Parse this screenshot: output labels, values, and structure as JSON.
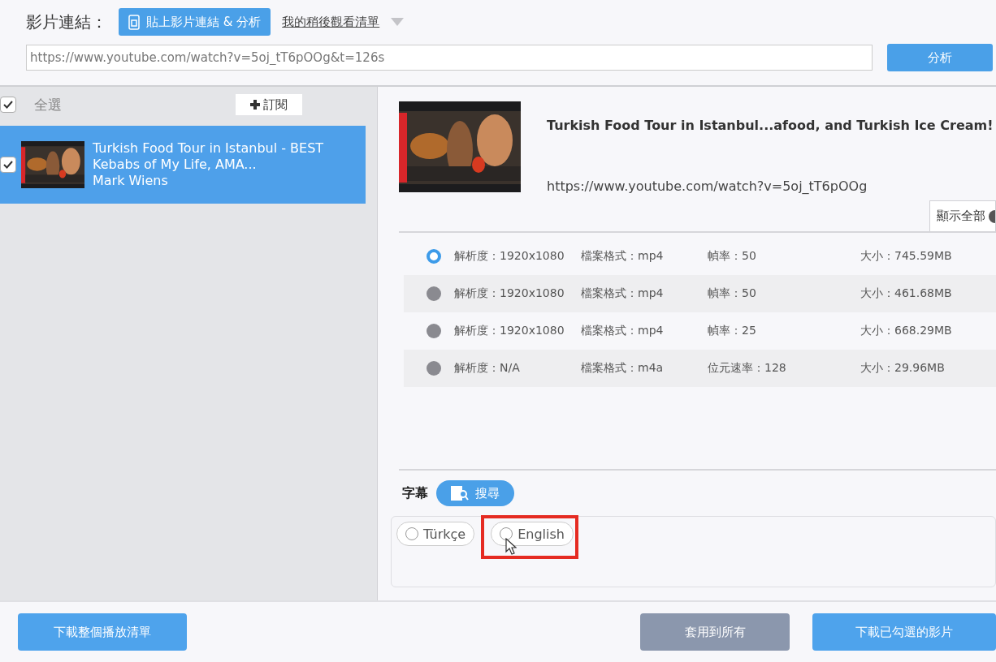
{
  "header": {
    "label": "影片連結：",
    "paste_button": "貼上影片連結 & 分析",
    "watch_later": "我的稍後觀看清單",
    "url_value": "https://www.youtube.com/watch?v=5oj_tT6pOOg&t=126s",
    "analyze_button": "分析"
  },
  "sidebar": {
    "select_all": {
      "label": "全選",
      "checked": true
    },
    "subscribe_button": "訂閱",
    "items": [
      {
        "title": "Turkish Food Tour in Istanbul - BEST Kebabs of My Life, AMA...",
        "author": "Mark Wiens",
        "checked": true,
        "selected": true,
        "kind": "picture"
      }
    ]
  },
  "detail": {
    "title": "Turkish Food Tour in Istanbul...afood, and Turkish Ice Cream!",
    "url": "https://www.youtube.com/watch?v=5oj_tT6pOOg",
    "show_all": "顯示全部",
    "formats": [
      {
        "resolution": "解析度：1920x1080",
        "format": "檔案格式：mp4",
        "rate": "幀率：50",
        "size": "大小：745.59MB",
        "selected": true
      },
      {
        "resolution": "解析度：1920x1080",
        "format": "檔案格式：mp4",
        "rate": "幀率：50",
        "size": "大小：461.68MB",
        "selected": false
      },
      {
        "resolution": "解析度：1920x1080",
        "format": "檔案格式：mp4",
        "rate": "幀率：25",
        "size": "大小：668.29MB",
        "selected": false
      },
      {
        "resolution": "解析度：N/A",
        "format": "檔案格式：m4a",
        "rate": "位元速率：128",
        "size": "大小：29.96MB",
        "selected": false
      }
    ],
    "subtitles": {
      "label": "字幕",
      "search_button": "搜尋",
      "languages": [
        {
          "label": "Türkçe",
          "selected": false,
          "highlighted": false,
          "pointer": false
        },
        {
          "label": "English",
          "selected": false,
          "highlighted": true,
          "pointer": true
        }
      ]
    }
  },
  "footer": {
    "download_playlist": "下載整個播放清單",
    "apply_all": "套用到所有",
    "download_checked": "下載已勾選的影片"
  }
}
